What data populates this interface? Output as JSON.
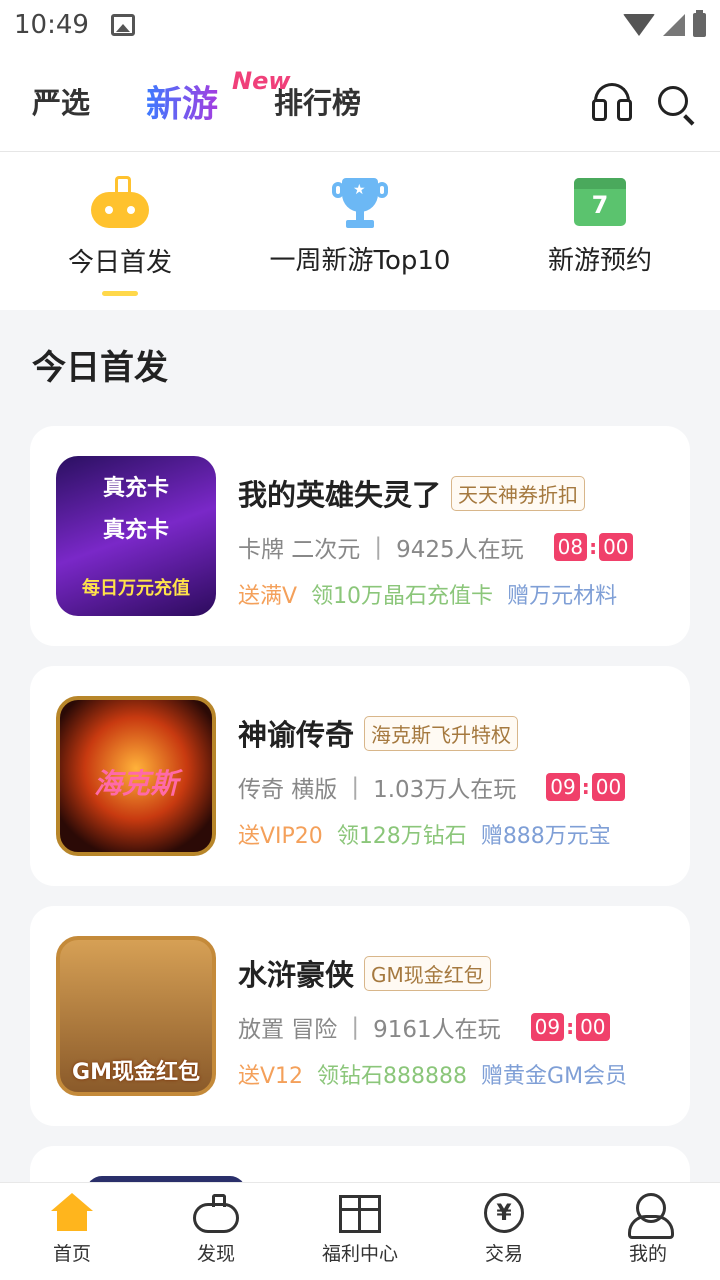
{
  "status_bar": {
    "time": "10:49"
  },
  "top_nav": {
    "tabs": [
      {
        "label": "严选"
      },
      {
        "label": "新游",
        "badge": "New"
      },
      {
        "label": "排行榜"
      }
    ],
    "icons": [
      "headset-icon",
      "search-icon"
    ]
  },
  "sub_nav": {
    "items": [
      {
        "label": "今日首发",
        "icon": "gamepad-icon"
      },
      {
        "label": "一周新游Top10",
        "icon": "trophy-icon"
      },
      {
        "label": "新游预约",
        "icon": "calendar-icon",
        "icon_text": "7"
      }
    ]
  },
  "section": {
    "title": "今日首发"
  },
  "games": [
    {
      "name": "我的英雄失灵了",
      "tag": "天天神券折扣",
      "genre": "卡牌 二次元",
      "players": "9425人在玩",
      "hour": "08",
      "minute": "00",
      "perk1": "送满V",
      "perk2": "领10万晶石充值卡",
      "perk3": "赠万元材料",
      "thumb_text_a": "真充卡",
      "thumb_text_b": "每日万元充值"
    },
    {
      "name": "神谕传奇",
      "tag": "海克斯飞升特权",
      "genre": "传奇 横版",
      "players": "1.03万人在玩",
      "hour": "09",
      "minute": "00",
      "perk1": "送VIP20",
      "perk2": "领128万钻石",
      "perk3": "赠888万元宝",
      "thumb_text_a": "海克斯"
    },
    {
      "name": "水浒豪侠",
      "tag": "GM现金红包",
      "genre": "放置 冒险",
      "players": "9161人在玩",
      "hour": "09",
      "minute": "00",
      "perk1": "送V12",
      "perk2": "领钻石888888",
      "perk3": "赠黄金GM会员",
      "thumb_text_a": "GM现金红包"
    }
  ],
  "bottom_nav": {
    "items": [
      {
        "label": "首页",
        "icon": "home-icon",
        "active": true
      },
      {
        "label": "发现",
        "icon": "gamepad-icon"
      },
      {
        "label": "福利中心",
        "icon": "gift-icon"
      },
      {
        "label": "交易",
        "icon": "yen-icon"
      },
      {
        "label": "我的",
        "icon": "user-icon"
      }
    ]
  },
  "colors": {
    "accent": "#ffb51d",
    "timer": "#f0406a",
    "perk1": "#f4a05a",
    "perk2": "#8bc67a",
    "perk3": "#7f9fd6"
  }
}
